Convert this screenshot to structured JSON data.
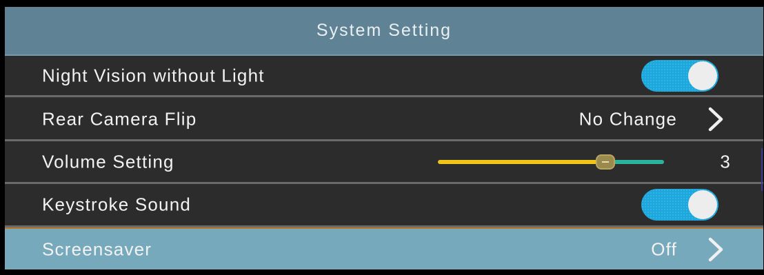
{
  "header": {
    "title": "System Setting"
  },
  "rows": [
    {
      "label": "Night Vision without Light",
      "control": "toggle",
      "state": "on"
    },
    {
      "label": "Rear Camera Flip",
      "control": "select",
      "value": "No Change",
      "icon": "chevron-right-icon"
    },
    {
      "label": "Volume Setting",
      "control": "slider",
      "value": "3",
      "level": 0.74
    },
    {
      "label": "Keystroke Sound",
      "control": "toggle",
      "state": "on"
    },
    {
      "label": "Screensaver",
      "control": "select",
      "value": "Off",
      "icon": "chevron-right-icon",
      "selected": true
    }
  ],
  "colors": {
    "header_bg": "#5f8395",
    "row_bg": "#2c2c2c",
    "selected_bg": "#76a9bb",
    "toggle_on": "#1fa7db",
    "slider_fill": "#f0c419",
    "slider_rest": "#2bb39e"
  }
}
